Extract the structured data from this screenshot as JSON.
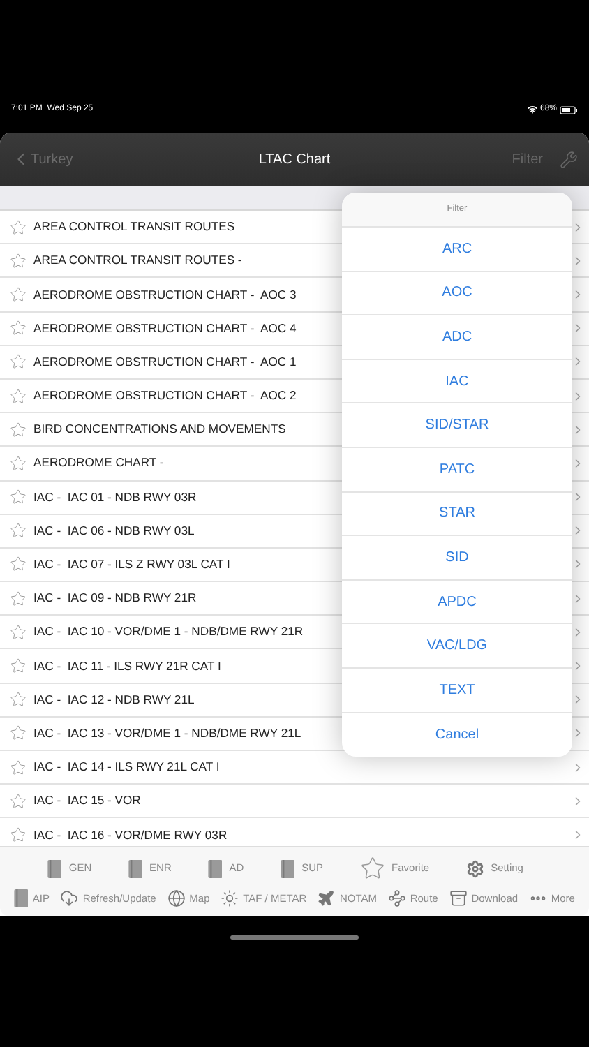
{
  "status_bar": {
    "time": "7:01 PM",
    "date": "Wed Sep 25",
    "battery": "68%"
  },
  "nav": {
    "back": "Turkey",
    "title": "LTAC Chart",
    "filter": "Filter"
  },
  "rows": [
    "AREA CONTROL TRANSIT ROUTES",
    "AREA CONTROL TRANSIT ROUTES -",
    "AERODROME OBSTRUCTION CHART -  AOC 3",
    "AERODROME OBSTRUCTION CHART -  AOC 4",
    "AERODROME OBSTRUCTION CHART -  AOC 1",
    "AERODROME OBSTRUCTION CHART -  AOC 2",
    "BIRD CONCENTRATIONS AND MOVEMENTS",
    "AERODROME CHART -",
    "IAC -  IAC 01 - NDB RWY 03R",
    "IAC -  IAC 06 - NDB RWY 03L",
    "IAC -  IAC 07 - ILS Z RWY 03L CAT I",
    "IAC -  IAC 09 - NDB RWY 21R",
    "IAC -  IAC 10 - VOR/DME 1 - NDB/DME RWY 21R",
    "IAC -  IAC 11 - ILS RWY 21R CAT I",
    "IAC -  IAC 12 - NDB RWY 21L",
    "IAC -  IAC 13 - VOR/DME 1 - NDB/DME RWY 21L",
    "IAC -  IAC 14 - ILS RWY 21L CAT I",
    "IAC -  IAC 15 - VOR",
    "IAC -  IAC 16 - VOR/DME RWY 03R"
  ],
  "filter_popover": {
    "title": "Filter",
    "options": [
      "ARC",
      "AOC",
      "ADC",
      "IAC",
      "SID/STAR",
      "PATC",
      "STAR",
      "SID",
      "APDC",
      "VAC/LDG",
      "TEXT"
    ],
    "cancel": "Cancel"
  },
  "tab_bar": {
    "row_1": [
      {
        "label": "GEN",
        "kind": "book"
      },
      {
        "label": "ENR",
        "kind": "book"
      },
      {
        "label": "AD",
        "kind": "book"
      },
      {
        "label": "SUP",
        "kind": "book"
      },
      {
        "label": "Favorite",
        "kind": "star"
      },
      {
        "label": "Setting",
        "kind": "gear"
      }
    ],
    "row_2": [
      {
        "label": "AIP",
        "kind": "book"
      },
      {
        "label": "Refresh/Update",
        "kind": "cloud"
      },
      {
        "label": "Map",
        "kind": "globe"
      },
      {
        "label": "TAF / METAR",
        "kind": "sun"
      },
      {
        "label": "NOTAM",
        "kind": "plane"
      },
      {
        "label": "Route",
        "kind": "route"
      },
      {
        "label": "Download",
        "kind": "cabinet"
      },
      {
        "label": "More",
        "kind": "more"
      }
    ]
  }
}
